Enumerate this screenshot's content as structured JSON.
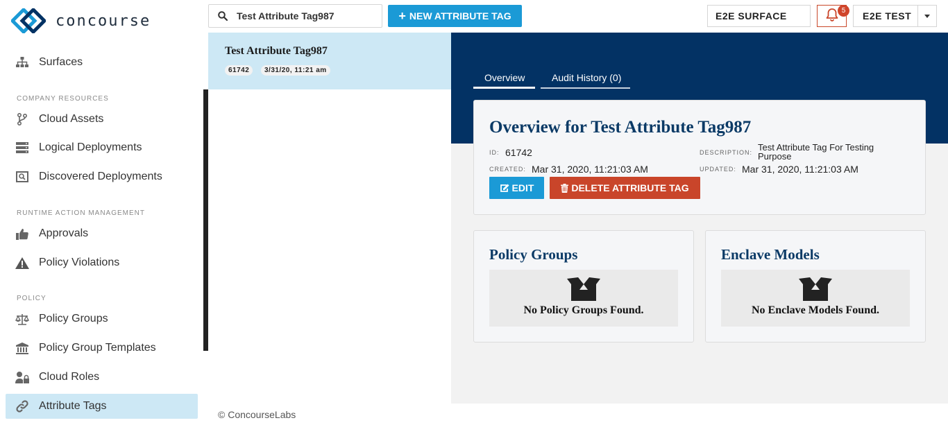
{
  "app": {
    "name": "concourse"
  },
  "sidebar": {
    "sections": {
      "company": "COMPANY RESOURCES",
      "runtime": "RUNTIME ACTION MANAGEMENT",
      "policy": "POLICY"
    },
    "items": {
      "surfaces": "Surfaces",
      "cloud_assets": "Cloud Assets",
      "logical_deployments": "Logical Deployments",
      "discovered_deployments": "Discovered Deployments",
      "approvals": "Approvals",
      "policy_violations": "Policy Violations",
      "policy_groups": "Policy Groups",
      "policy_group_templates": "Policy Group Templates",
      "cloud_roles": "Cloud Roles",
      "attribute_tags": "Attribute Tags"
    }
  },
  "topbar": {
    "search_value": "Test Attribute Tag987",
    "new_button": "NEW ATTRIBUTE TAG",
    "surface": "E2E SURFACE",
    "notification_count": "5",
    "user": "E2E TEST"
  },
  "list": {
    "items": [
      {
        "title": "Test Attribute Tag987",
        "id": "61742",
        "date": "3/31/20, 11:21 am"
      }
    ]
  },
  "detail": {
    "tabs": {
      "overview": "Overview",
      "audit": "Audit History (0)"
    },
    "title": "Overview for Test Attribute Tag987",
    "id_label": "ID:",
    "id": "61742",
    "created_label": "CREATED:",
    "created": "Mar 31, 2020, 11:21:03 AM",
    "description_label": "DESCRIPTION:",
    "description_line1": "Test Attribute Tag For Testing",
    "description_line2": "Purpose",
    "updated_label": "UPDATED:",
    "updated": "Mar 31, 2020, 11:21:03 AM",
    "edit_button": "EDIT",
    "delete_button": "DELETE ATTRIBUTE TAG",
    "policy_groups": {
      "title": "Policy Groups",
      "empty": "No Policy Groups Found."
    },
    "enclave_models": {
      "title": "Enclave Models",
      "empty": "No Enclave Models Found."
    }
  },
  "footer": {
    "copyright": "© ConcourseLabs"
  },
  "colors": {
    "brand_blue": "#1b9ad6",
    "navy": "#033264",
    "danger": "#c9452a",
    "active_nav": "#cde8f5"
  }
}
